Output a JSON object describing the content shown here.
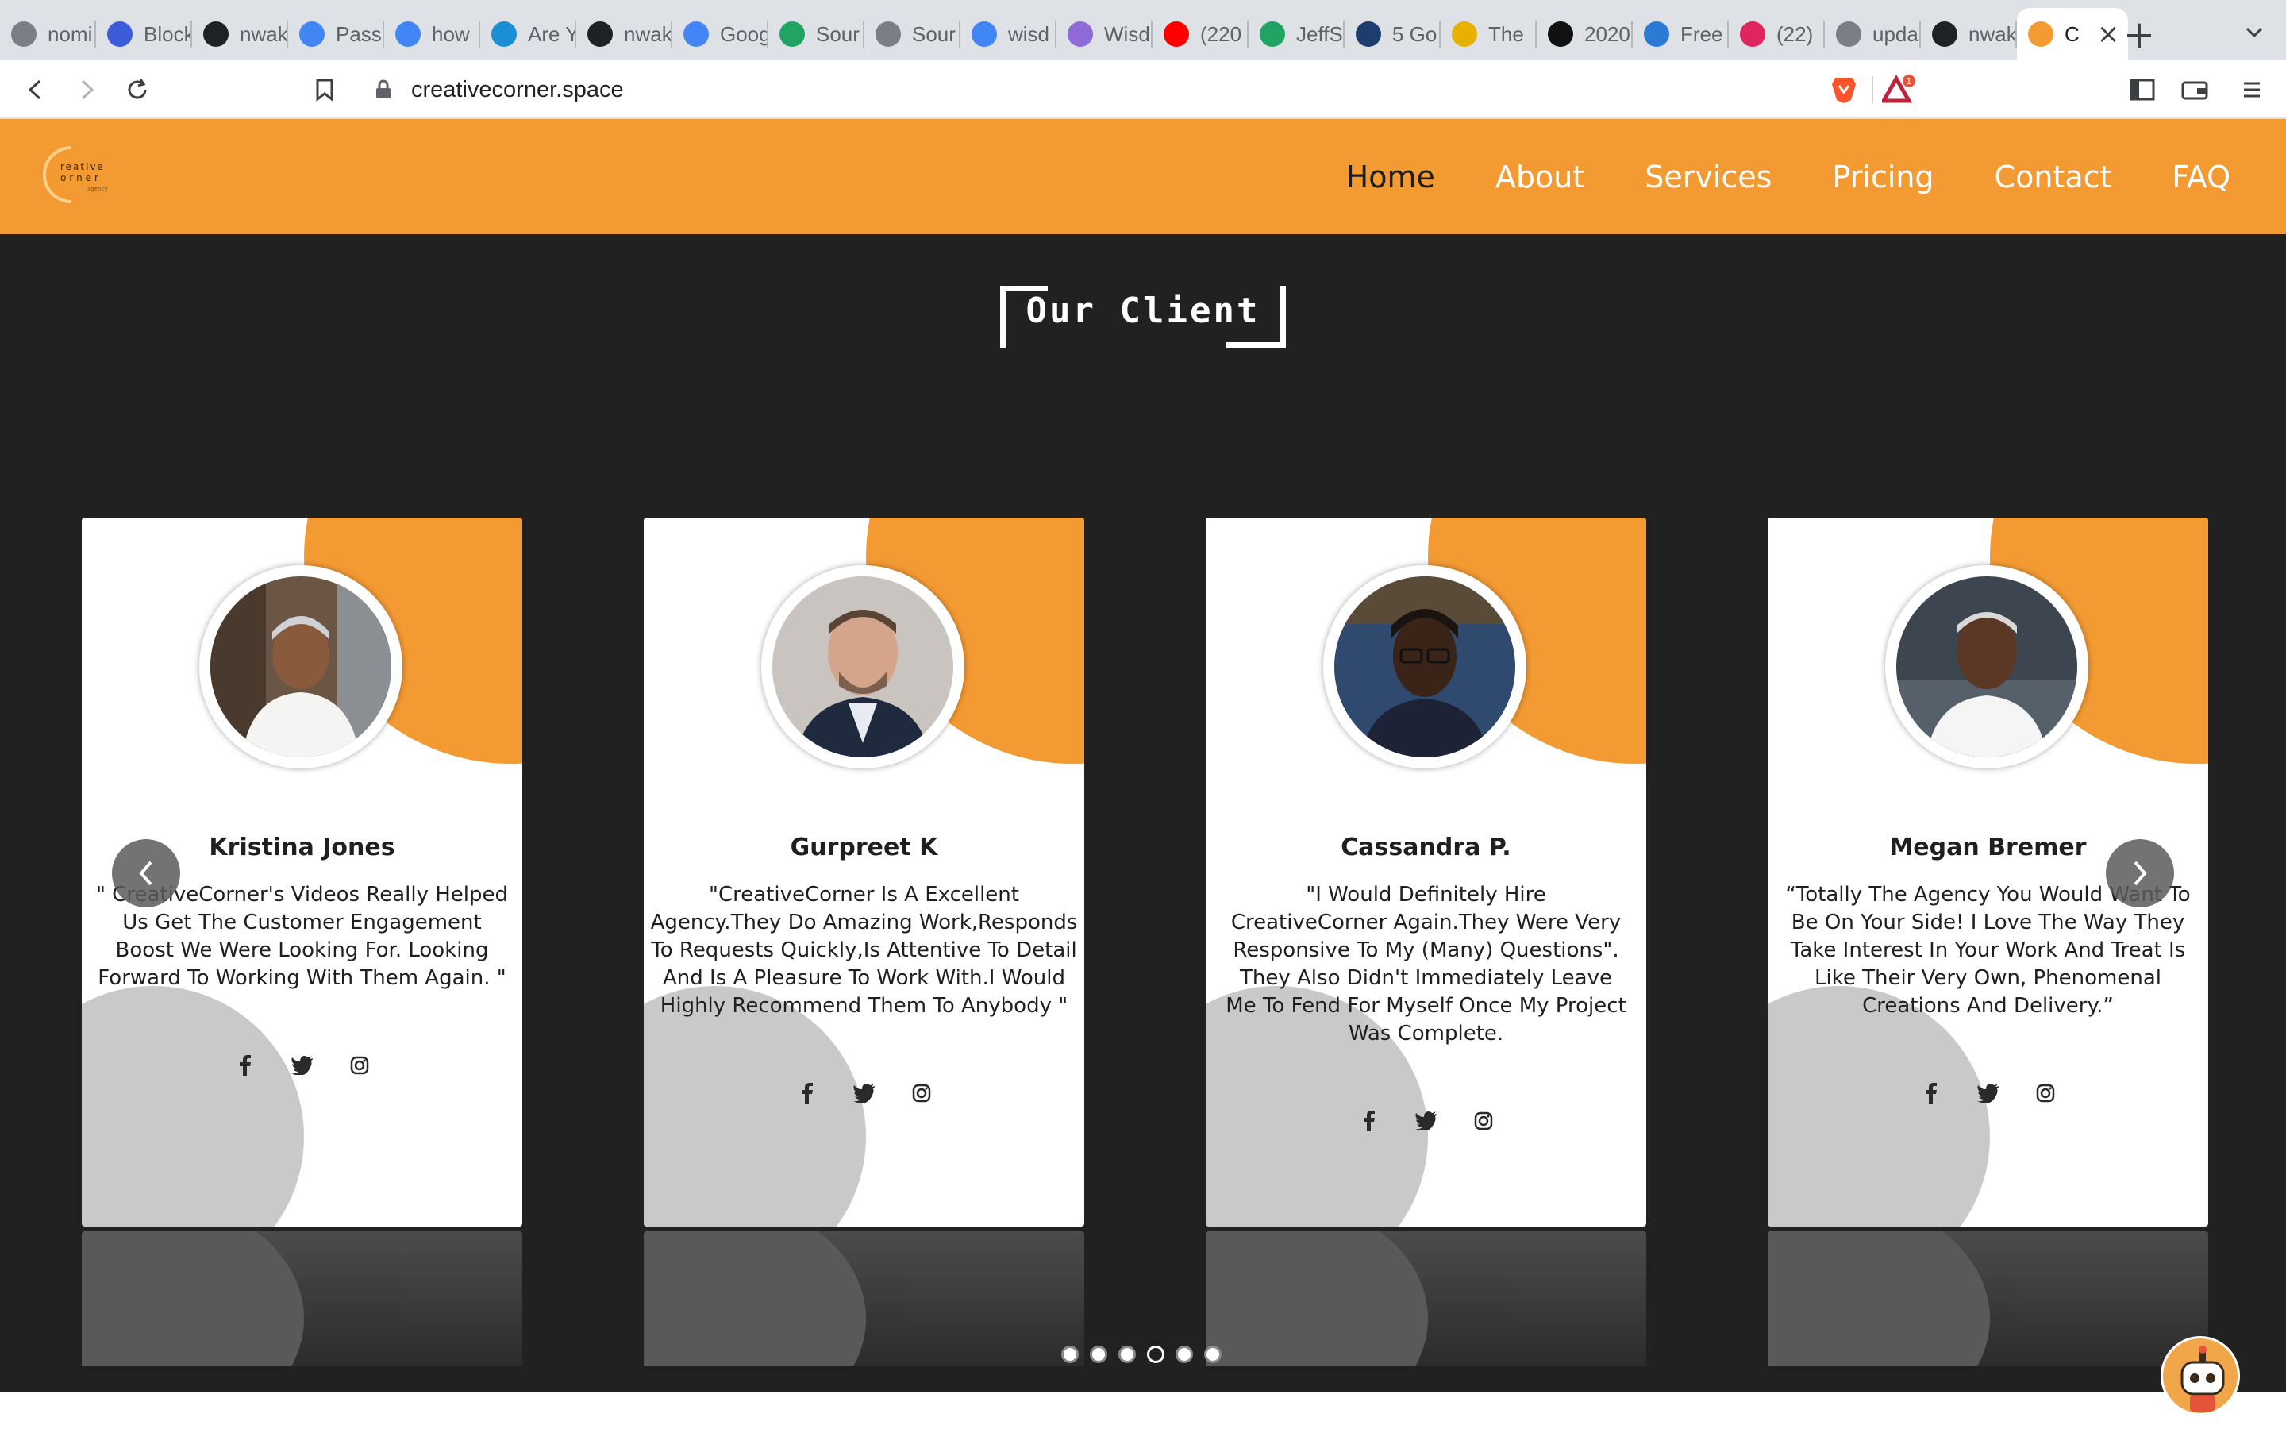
{
  "browser": {
    "tabs": [
      {
        "label": "nomi",
        "icon": "globe-icon",
        "color": "#7a7f86"
      },
      {
        "label": "Block",
        "icon": "hexagon-icon",
        "color": "#3b5bdb"
      },
      {
        "label": "nwak",
        "icon": "github-icon",
        "color": "#202124"
      },
      {
        "label": "Pass",
        "icon": "google-icon",
        "color": "#4285f4"
      },
      {
        "label": "how",
        "icon": "google-icon",
        "color": "#4285f4"
      },
      {
        "label": "Are Y",
        "icon": "mk-icon",
        "color": "#1a8fd6"
      },
      {
        "label": "nwak",
        "icon": "github-icon",
        "color": "#202124"
      },
      {
        "label": "Goog",
        "icon": "google-icon",
        "color": "#4285f4"
      },
      {
        "label": "Sour",
        "icon": "drive-icon",
        "color": "#1fa463"
      },
      {
        "label": "Sour",
        "icon": "globe-icon",
        "color": "#7a7f86"
      },
      {
        "label": "wisd",
        "icon": "docs-icon",
        "color": "#4285f4"
      },
      {
        "label": "Wisd",
        "icon": "wisdom-icon",
        "color": "#8e6bd6"
      },
      {
        "label": "(220",
        "icon": "youtube-icon",
        "color": "#ff0000"
      },
      {
        "label": "JeffS",
        "icon": "drive-icon",
        "color": "#1fa463"
      },
      {
        "label": "5 Go",
        "icon": "shield-icon",
        "color": "#1c3d6e"
      },
      {
        "label": "The",
        "icon": "nbc-icon",
        "color": "#e8b100"
      },
      {
        "label": "2020",
        "icon": "u-icon",
        "color": "#111111"
      },
      {
        "label": "Free",
        "icon": "shield-check-icon",
        "color": "#2b7bd6"
      },
      {
        "label": "(22)",
        "icon": "badge-icon",
        "color": "#e0245e"
      },
      {
        "label": "upda",
        "icon": "globe-icon",
        "color": "#7a7f86"
      },
      {
        "label": "nwak",
        "icon": "github-icon",
        "color": "#202124"
      },
      {
        "label": "C",
        "icon": "creativecorner-icon",
        "color": "#f39a33"
      }
    ],
    "new_tab": "+",
    "url": "creativecorner.space",
    "brave_badge": "1"
  },
  "site": {
    "brand_color": "#f39a33",
    "logo_text": [
      "reative",
      "orner",
      "agency"
    ],
    "nav": [
      {
        "label": "Home",
        "active": true
      },
      {
        "label": "About",
        "active": false
      },
      {
        "label": "Services",
        "active": false
      },
      {
        "label": "Pricing",
        "active": false
      },
      {
        "label": "Contact",
        "active": false
      },
      {
        "label": "FAQ",
        "active": false
      }
    ],
    "section_title": "Our Client",
    "testimonials": [
      {
        "name": "Kristina Jones",
        "quote": "\" CreativeCorner's Videos Really Helped Us Get The Customer Engagement Boost We Were Looking For. Looking Forward To Working With Them Again. \""
      },
      {
        "name": "Gurpreet K",
        "quote": "\"CreativeCorner Is A Excellent Agency.They Do Amazing Work,Responds To Requests Quickly,Is Attentive To Detail And Is A Pleasure To Work With.I Would Highly Recommend Them To Anybody \""
      },
      {
        "name": "Cassandra P.",
        "quote": "\"I Would Definitely Hire CreativeCorner Again.They Were Very Responsive To My (Many) Questions\". They Also Didn't Immediately Leave Me To Fend For Myself Once My Project Was Complete."
      },
      {
        "name": "Megan Bremer",
        "quote": "“Totally The Agency You Would Want To Be On Your Side! I Love The Way They Take Interest In Your Work And Treat Is Like Their Very Own, Phenomenal Creations And Delivery.”"
      }
    ],
    "social_icons": [
      "facebook-icon",
      "twitter-icon",
      "instagram-icon"
    ],
    "carousel": {
      "dot_count": 6,
      "active_dot": 4
    }
  }
}
